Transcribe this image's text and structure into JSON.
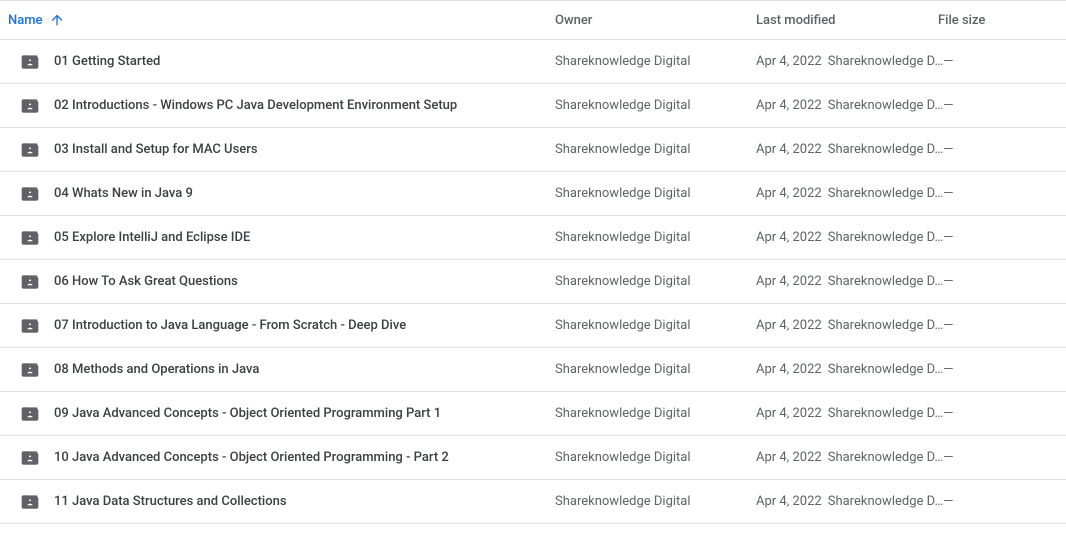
{
  "columns": {
    "name": "Name",
    "owner": "Owner",
    "modified": "Last modified",
    "size": "File size"
  },
  "rows": [
    {
      "name": "01 Getting Started",
      "owner": "Shareknowledge Digital",
      "date": "Apr 4, 2022",
      "modifiedBy": "Shareknowledge D…",
      "size": "—"
    },
    {
      "name": "02 Introductions - Windows PC Java Development Environment Setup",
      "owner": "Shareknowledge Digital",
      "date": "Apr 4, 2022",
      "modifiedBy": "Shareknowledge D…",
      "size": "—"
    },
    {
      "name": "03 Install and Setup for MAC Users",
      "owner": "Shareknowledge Digital",
      "date": "Apr 4, 2022",
      "modifiedBy": "Shareknowledge D…",
      "size": "—"
    },
    {
      "name": "04 Whats New in Java 9",
      "owner": "Shareknowledge Digital",
      "date": "Apr 4, 2022",
      "modifiedBy": "Shareknowledge D…",
      "size": "—"
    },
    {
      "name": "05 Explore IntelliJ and Eclipse IDE",
      "owner": "Shareknowledge Digital",
      "date": "Apr 4, 2022",
      "modifiedBy": "Shareknowledge D…",
      "size": "—"
    },
    {
      "name": "06 How To Ask Great Questions",
      "owner": "Shareknowledge Digital",
      "date": "Apr 4, 2022",
      "modifiedBy": "Shareknowledge D…",
      "size": "—"
    },
    {
      "name": "07 Introduction to Java Language - From Scratch - Deep Dive",
      "owner": "Shareknowledge Digital",
      "date": "Apr 4, 2022",
      "modifiedBy": "Shareknowledge D…",
      "size": "—"
    },
    {
      "name": "08 Methods and Operations in Java",
      "owner": "Shareknowledge Digital",
      "date": "Apr 4, 2022",
      "modifiedBy": "Shareknowledge D…",
      "size": "—"
    },
    {
      "name": "09 Java Advanced Concepts - Object Oriented Programming Part 1",
      "owner": "Shareknowledge Digital",
      "date": "Apr 4, 2022",
      "modifiedBy": "Shareknowledge D…",
      "size": "—"
    },
    {
      "name": "10 Java Advanced Concepts - Object Oriented Programming - Part 2",
      "owner": "Shareknowledge Digital",
      "date": "Apr 4, 2022",
      "modifiedBy": "Shareknowledge D…",
      "size": "—"
    },
    {
      "name": "11 Java Data Structures and Collections",
      "owner": "Shareknowledge Digital",
      "date": "Apr 4, 2022",
      "modifiedBy": "Shareknowledge D…",
      "size": "—"
    }
  ]
}
